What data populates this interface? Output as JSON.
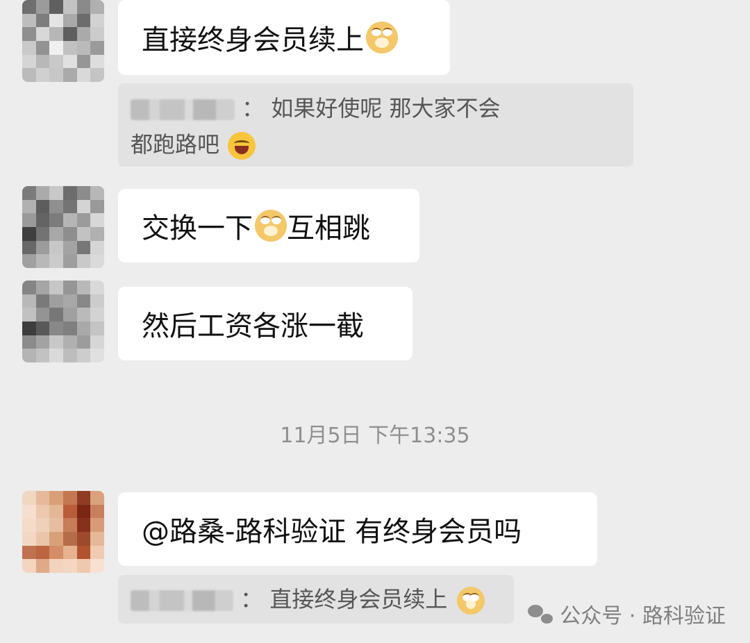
{
  "messages": [
    {
      "text": "直接终身会员续上",
      "emoji": "shiba-dog-emoji"
    },
    {
      "text": "交换一下",
      "emoji": "shiba-dog-emoji",
      "suffix": "互相跳"
    },
    {
      "text": "然后工资各涨一截"
    },
    {
      "text": "@路桑-路科验证  有终身会员吗"
    }
  ],
  "quotes": [
    {
      "separator": "：",
      "text_line1": "如果好使呢 那大家不会",
      "text_line2": "都跑路吧",
      "emoji": "tears-of-joy-emoji"
    },
    {
      "separator": "：",
      "text": "直接终身会员续上",
      "emoji": "shiba-dog-emoji"
    }
  ],
  "timestamp": "11月5日 下午13:35",
  "watermark": {
    "icon": "wechat-icon",
    "text": "公众号 · 路科验证"
  },
  "colors": {
    "background": "#ededed",
    "bubble": "#ffffff",
    "quote": "#e2e2e2"
  }
}
